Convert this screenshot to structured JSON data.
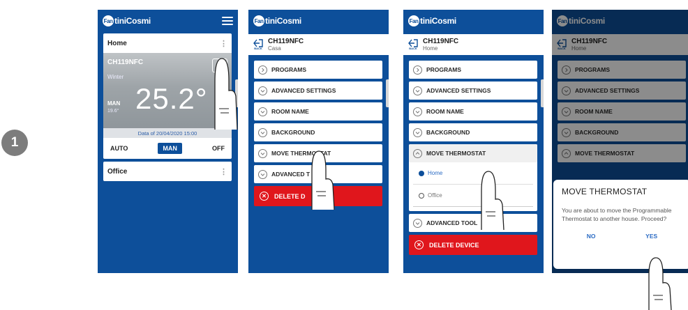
{
  "step_number": "1",
  "brand": "FantiniCosmi",
  "logo_mark": "Fan",
  "logo_rest": "tiniCosmi",
  "screen1": {
    "home_label": "Home",
    "device": "CH119NFC",
    "season": "Winter",
    "temperature": "25.2°",
    "mode_label": "MAN",
    "setpoint": "19.6°",
    "date_text": "Data of 20/04/2020 15:00",
    "modes": [
      "AUTO",
      "MAN",
      "OFF"
    ],
    "office_label": "Office"
  },
  "detail": {
    "device": "CH119NFC",
    "back_label": "BACK",
    "sub_casa": "Casa",
    "sub_home": "Home",
    "items": {
      "programs": "PROGRAMS",
      "advanced_settings": "ADVANCED SETTINGS",
      "room_name": "ROOM NAME",
      "background": "BACKGROUND",
      "move_thermostat": "MOVE THERMOSTAT",
      "advanced_tools": "ADVANCED TOOLS",
      "advanced_tools_cut_s2": "ADVANCED T",
      "advanced_tools_cut_s3": "ADVANCED TOOL",
      "delete_device": "DELETE DEVICE",
      "delete_device_cut": "DELETE D"
    },
    "houses": [
      "Home",
      "Office"
    ]
  },
  "dialog": {
    "title": "MOVE THERMOSTAT",
    "body": "You are about to move the Programmable Thermostat to another house. Proceed?",
    "no": "NO",
    "yes": "YES"
  },
  "colors": {
    "brand_blue": "#0d4f9a",
    "delete_red": "#e0161c",
    "link_blue": "#2b6bc4"
  }
}
